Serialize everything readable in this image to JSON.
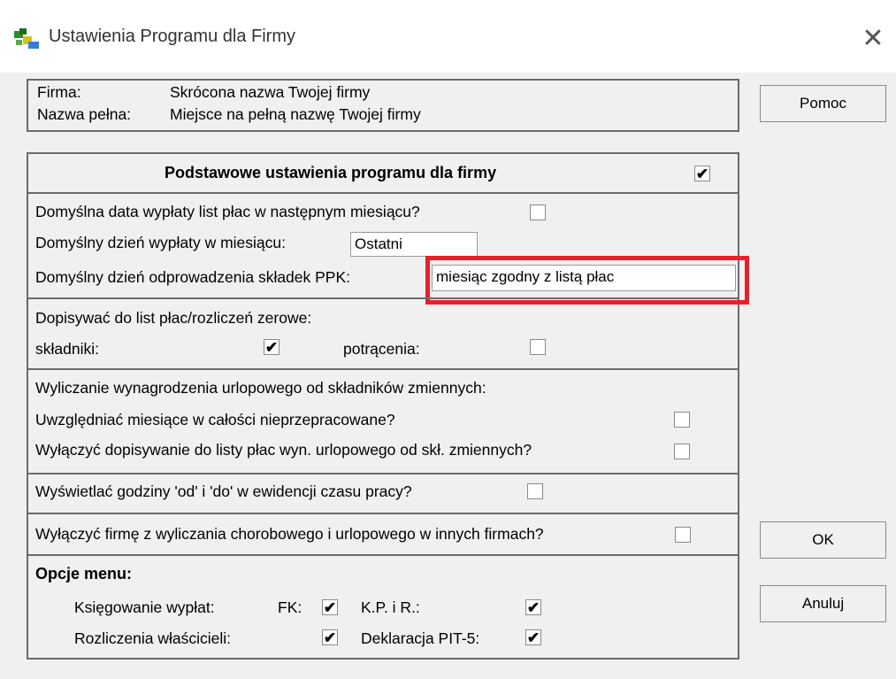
{
  "window": {
    "title": "Ustawienia Programu dla Firmy",
    "close": "✕"
  },
  "company": {
    "firma_label": "Firma:",
    "firma_value": "Skrócona nazwa Twojej firmy",
    "full_label": "Nazwa pełna:",
    "full_value": "Miejsce na pełną nazwę Twojej firmy"
  },
  "basic": {
    "header": "Podstawowe ustawienia programu dla firmy",
    "header_checked": "✔",
    "payday_next_month": "Domyślna data wypłaty list płac w następnym miesiącu?",
    "payday_label": "Domyślny dzień wypłaty w miesiącu:",
    "payday_value": "Ostatni",
    "ppk_label": "Domyślny dzień odprowadzenia składek PPK:",
    "ppk_value": "miesiąc zgodny z listą płac"
  },
  "zero": {
    "label": "Dopisywać do list płac/rozliczeń zerowe:",
    "components": "składniki:",
    "components_check": "✔",
    "deductions": "potrącenia:"
  },
  "vacation": {
    "label": "Wyliczanie wynagrodzenia urlopowego od składników zmiennych:",
    "months_q": "Uwzględniać miesiące w całości nieprzepracowane?",
    "disable_q": "Wyłączyć dopisywanie do listy płac wyn. urlopowego od skł. zmiennych?"
  },
  "hours": {
    "label": "Wyświetlać godziny 'od' i 'do' w ewidencji czasu pracy?"
  },
  "exclude": {
    "label": "Wyłączyć firmę z wyliczania chorobowego i urlopowego w innych firmach?"
  },
  "menu": {
    "header": "Opcje menu:",
    "bookkeeping": "Księgowanie wypłat:",
    "fk": "FK:",
    "fk_check": "✔",
    "kpir": "K.P. i R.:",
    "kpir_check": "✔",
    "owners": "Rozliczenia właścicieli:",
    "owners_check": "✔",
    "pit5": "Deklaracja PIT-5:",
    "pit5_check": "✔"
  },
  "buttons": {
    "help": "Pomoc",
    "ok": "OK",
    "cancel": "Anuluj"
  },
  "colors": {
    "highlight": "#e8202a",
    "frame": "#6b6b6b",
    "dialog_bg": "#f0f0f0"
  }
}
